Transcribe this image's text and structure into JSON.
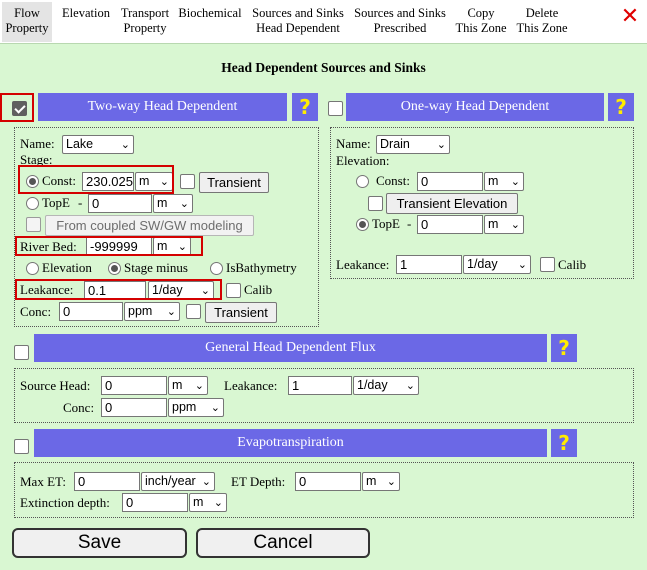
{
  "tabs": [
    {
      "line1": "Flow",
      "line2": "Property"
    },
    {
      "line1": "Elevation",
      "line2": ""
    },
    {
      "line1": "Transport",
      "line2": "Property"
    },
    {
      "line1": "Biochemical",
      "line2": ""
    },
    {
      "line1": "Sources and Sinks",
      "line2": "Head Dependent"
    },
    {
      "line1": "Sources and Sinks",
      "line2": "Prescribed"
    },
    {
      "line1": "Copy",
      "line2": "This Zone"
    },
    {
      "line1": "Delete",
      "line2": "This Zone"
    }
  ],
  "close_glyph": "✕",
  "page_title": "Head Dependent Sources and Sinks",
  "help_glyph": "?",
  "two_way": {
    "header": "Two-way Head Dependent",
    "name_label": "Name:",
    "name_value": "Lake",
    "stage_label": "Stage:",
    "const_label": "Const:",
    "const_value": "230.025",
    "const_unit": "m",
    "transient_label": "Transient",
    "tope_label": "TopE",
    "dash": "-",
    "tope_value": "0",
    "tope_unit": "m",
    "coupled_label": "From coupled SW/GW modeling",
    "riverbed_label": "River Bed:",
    "riverbed_value": "-999999",
    "riverbed_unit": "m",
    "opt_elevation": "Elevation",
    "opt_stage_minus": "Stage minus",
    "opt_isbathymetry": "IsBathymetry",
    "leakance_label": "Leakance:",
    "leakance_value": "0.1",
    "leakance_unit": "1/day",
    "calib_label": "Calib",
    "conc_label": "Conc:",
    "conc_value": "0",
    "conc_unit": "ppm",
    "conc_transient_label": "Transient"
  },
  "one_way": {
    "header": "One-way Head Dependent",
    "name_label": "Name:",
    "name_value": "Drain",
    "elevation_label": "Elevation:",
    "const_label": "Const:",
    "const_value": "0",
    "const_unit": "m",
    "transient_elev_label": "Transient Elevation",
    "tope_label": "TopE",
    "dash": "-",
    "tope_value": "0",
    "tope_unit": "m",
    "leakance_label": "Leakance:",
    "leakance_value": "1",
    "leakance_unit": "1/day",
    "calib_label": "Calib"
  },
  "ghd": {
    "header": "General Head Dependent Flux",
    "source_head_label": "Source Head:",
    "source_head_value": "0",
    "source_head_unit": "m",
    "leakance_label": "Leakance:",
    "leakance_value": "1",
    "leakance_unit": "1/day",
    "conc_label": "Conc:",
    "conc_value": "0",
    "conc_unit": "ppm"
  },
  "et": {
    "header": "Evapotranspiration",
    "max_et_label": "Max ET:",
    "max_et_value": "0",
    "max_et_unit": "inch/year",
    "et_depth_label": "ET Depth:",
    "et_depth_value": "0",
    "et_depth_unit": "m",
    "ext_depth_label": "Extinction depth:",
    "ext_depth_value": "0",
    "ext_depth_unit": "m"
  },
  "save_label": "Save",
  "cancel_label": "Cancel",
  "chevron": "⌄",
  "colors": {
    "header": "#6b68e6",
    "help": "#ffec00",
    "highlight": "#d40000",
    "bg": "#d9f7d2",
    "close": "#e00000"
  }
}
